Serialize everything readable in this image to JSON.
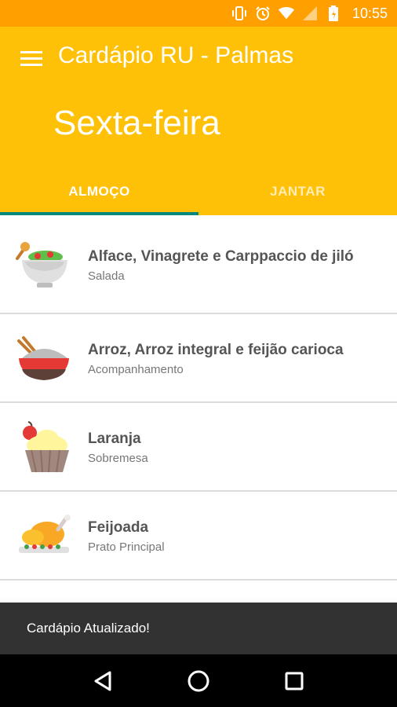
{
  "status_bar": {
    "time": "10:55",
    "icons": [
      "vibrate-icon",
      "alarm-icon",
      "wifi-icon",
      "signal-icon",
      "battery-icon"
    ]
  },
  "app_bar": {
    "title": "Cardápio RU - Palmas",
    "day": "Sexta-feira",
    "color": "#FFC107",
    "status_color": "#FFA000",
    "indicator_color": "#00897B"
  },
  "tabs": [
    {
      "label": "ALMOÇO",
      "active": true
    },
    {
      "label": "JANTAR",
      "active": false
    }
  ],
  "menu": [
    {
      "dish": "Alface, Vinagrete e Carppaccio de jiló",
      "category": "Salada",
      "icon": "salad-bowl-icon"
    },
    {
      "dish": "Arroz, Arroz integral e feijão carioca",
      "category": "Acompanhamento",
      "icon": "rice-bowl-icon"
    },
    {
      "dish": "Laranja",
      "category": "Sobremesa",
      "icon": "cupcake-icon"
    },
    {
      "dish": "Feijoada",
      "category": "Prato Principal",
      "icon": "roast-chicken-icon"
    }
  ],
  "snackbar": {
    "message": "Cardápio Atualizado!"
  },
  "nav_bar": {
    "buttons": [
      "back-icon",
      "home-icon",
      "recents-icon"
    ]
  }
}
